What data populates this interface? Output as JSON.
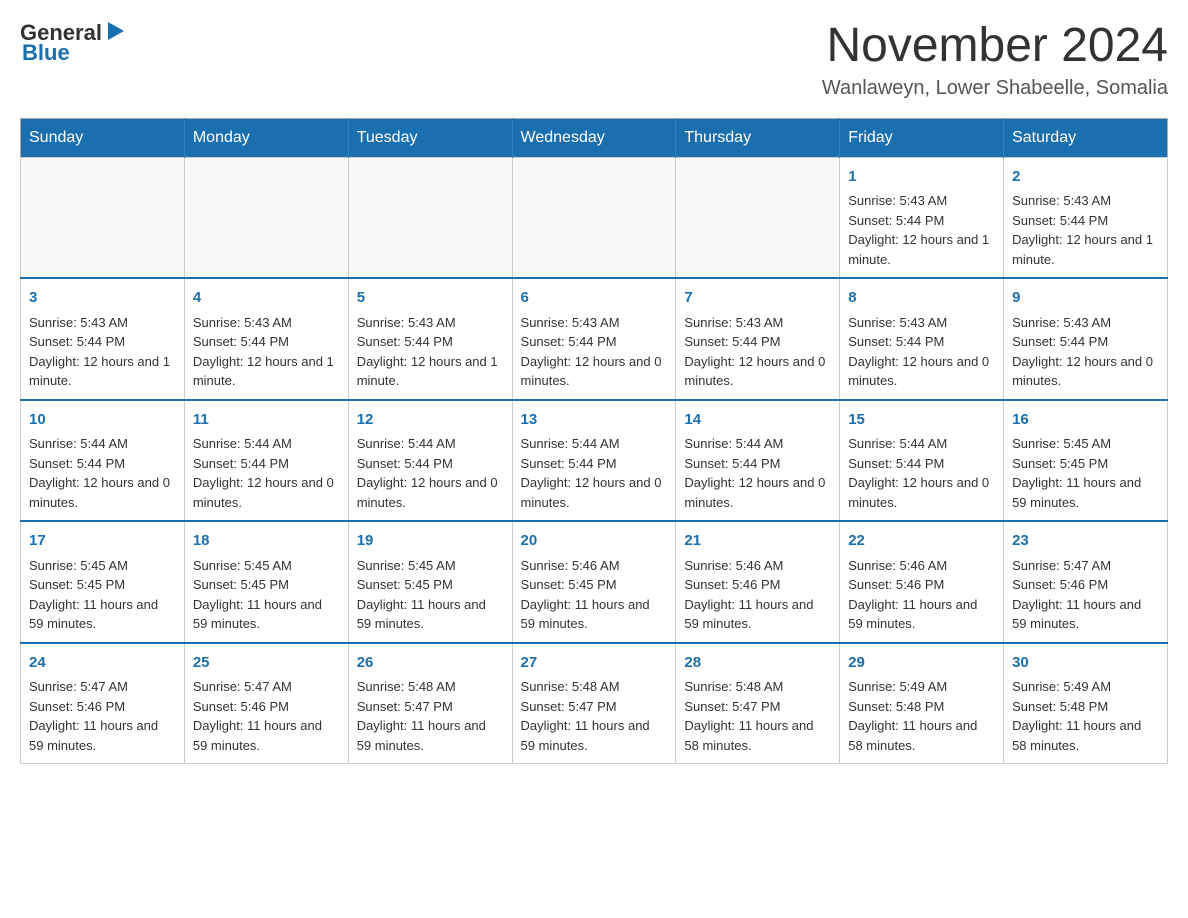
{
  "header": {
    "logo_general": "General",
    "logo_blue": "Blue",
    "month_title": "November 2024",
    "location": "Wanlaweyn, Lower Shabeelle, Somalia"
  },
  "weekdays": [
    "Sunday",
    "Monday",
    "Tuesday",
    "Wednesday",
    "Thursday",
    "Friday",
    "Saturday"
  ],
  "weeks": [
    {
      "days": [
        {
          "number": "",
          "sunrise": "",
          "sunset": "",
          "daylight": "",
          "empty": true
        },
        {
          "number": "",
          "sunrise": "",
          "sunset": "",
          "daylight": "",
          "empty": true
        },
        {
          "number": "",
          "sunrise": "",
          "sunset": "",
          "daylight": "",
          "empty": true
        },
        {
          "number": "",
          "sunrise": "",
          "sunset": "",
          "daylight": "",
          "empty": true
        },
        {
          "number": "",
          "sunrise": "",
          "sunset": "",
          "daylight": "",
          "empty": true
        },
        {
          "number": "1",
          "sunrise": "Sunrise: 5:43 AM",
          "sunset": "Sunset: 5:44 PM",
          "daylight": "Daylight: 12 hours and 1 minute.",
          "empty": false
        },
        {
          "number": "2",
          "sunrise": "Sunrise: 5:43 AM",
          "sunset": "Sunset: 5:44 PM",
          "daylight": "Daylight: 12 hours and 1 minute.",
          "empty": false
        }
      ]
    },
    {
      "days": [
        {
          "number": "3",
          "sunrise": "Sunrise: 5:43 AM",
          "sunset": "Sunset: 5:44 PM",
          "daylight": "Daylight: 12 hours and 1 minute.",
          "empty": false
        },
        {
          "number": "4",
          "sunrise": "Sunrise: 5:43 AM",
          "sunset": "Sunset: 5:44 PM",
          "daylight": "Daylight: 12 hours and 1 minute.",
          "empty": false
        },
        {
          "number": "5",
          "sunrise": "Sunrise: 5:43 AM",
          "sunset": "Sunset: 5:44 PM",
          "daylight": "Daylight: 12 hours and 1 minute.",
          "empty": false
        },
        {
          "number": "6",
          "sunrise": "Sunrise: 5:43 AM",
          "sunset": "Sunset: 5:44 PM",
          "daylight": "Daylight: 12 hours and 0 minutes.",
          "empty": false
        },
        {
          "number": "7",
          "sunrise": "Sunrise: 5:43 AM",
          "sunset": "Sunset: 5:44 PM",
          "daylight": "Daylight: 12 hours and 0 minutes.",
          "empty": false
        },
        {
          "number": "8",
          "sunrise": "Sunrise: 5:43 AM",
          "sunset": "Sunset: 5:44 PM",
          "daylight": "Daylight: 12 hours and 0 minutes.",
          "empty": false
        },
        {
          "number": "9",
          "sunrise": "Sunrise: 5:43 AM",
          "sunset": "Sunset: 5:44 PM",
          "daylight": "Daylight: 12 hours and 0 minutes.",
          "empty": false
        }
      ]
    },
    {
      "days": [
        {
          "number": "10",
          "sunrise": "Sunrise: 5:44 AM",
          "sunset": "Sunset: 5:44 PM",
          "daylight": "Daylight: 12 hours and 0 minutes.",
          "empty": false
        },
        {
          "number": "11",
          "sunrise": "Sunrise: 5:44 AM",
          "sunset": "Sunset: 5:44 PM",
          "daylight": "Daylight: 12 hours and 0 minutes.",
          "empty": false
        },
        {
          "number": "12",
          "sunrise": "Sunrise: 5:44 AM",
          "sunset": "Sunset: 5:44 PM",
          "daylight": "Daylight: 12 hours and 0 minutes.",
          "empty": false
        },
        {
          "number": "13",
          "sunrise": "Sunrise: 5:44 AM",
          "sunset": "Sunset: 5:44 PM",
          "daylight": "Daylight: 12 hours and 0 minutes.",
          "empty": false
        },
        {
          "number": "14",
          "sunrise": "Sunrise: 5:44 AM",
          "sunset": "Sunset: 5:44 PM",
          "daylight": "Daylight: 12 hours and 0 minutes.",
          "empty": false
        },
        {
          "number": "15",
          "sunrise": "Sunrise: 5:44 AM",
          "sunset": "Sunset: 5:44 PM",
          "daylight": "Daylight: 12 hours and 0 minutes.",
          "empty": false
        },
        {
          "number": "16",
          "sunrise": "Sunrise: 5:45 AM",
          "sunset": "Sunset: 5:45 PM",
          "daylight": "Daylight: 11 hours and 59 minutes.",
          "empty": false
        }
      ]
    },
    {
      "days": [
        {
          "number": "17",
          "sunrise": "Sunrise: 5:45 AM",
          "sunset": "Sunset: 5:45 PM",
          "daylight": "Daylight: 11 hours and 59 minutes.",
          "empty": false
        },
        {
          "number": "18",
          "sunrise": "Sunrise: 5:45 AM",
          "sunset": "Sunset: 5:45 PM",
          "daylight": "Daylight: 11 hours and 59 minutes.",
          "empty": false
        },
        {
          "number": "19",
          "sunrise": "Sunrise: 5:45 AM",
          "sunset": "Sunset: 5:45 PM",
          "daylight": "Daylight: 11 hours and 59 minutes.",
          "empty": false
        },
        {
          "number": "20",
          "sunrise": "Sunrise: 5:46 AM",
          "sunset": "Sunset: 5:45 PM",
          "daylight": "Daylight: 11 hours and 59 minutes.",
          "empty": false
        },
        {
          "number": "21",
          "sunrise": "Sunrise: 5:46 AM",
          "sunset": "Sunset: 5:46 PM",
          "daylight": "Daylight: 11 hours and 59 minutes.",
          "empty": false
        },
        {
          "number": "22",
          "sunrise": "Sunrise: 5:46 AM",
          "sunset": "Sunset: 5:46 PM",
          "daylight": "Daylight: 11 hours and 59 minutes.",
          "empty": false
        },
        {
          "number": "23",
          "sunrise": "Sunrise: 5:47 AM",
          "sunset": "Sunset: 5:46 PM",
          "daylight": "Daylight: 11 hours and 59 minutes.",
          "empty": false
        }
      ]
    },
    {
      "days": [
        {
          "number": "24",
          "sunrise": "Sunrise: 5:47 AM",
          "sunset": "Sunset: 5:46 PM",
          "daylight": "Daylight: 11 hours and 59 minutes.",
          "empty": false
        },
        {
          "number": "25",
          "sunrise": "Sunrise: 5:47 AM",
          "sunset": "Sunset: 5:46 PM",
          "daylight": "Daylight: 11 hours and 59 minutes.",
          "empty": false
        },
        {
          "number": "26",
          "sunrise": "Sunrise: 5:48 AM",
          "sunset": "Sunset: 5:47 PM",
          "daylight": "Daylight: 11 hours and 59 minutes.",
          "empty": false
        },
        {
          "number": "27",
          "sunrise": "Sunrise: 5:48 AM",
          "sunset": "Sunset: 5:47 PM",
          "daylight": "Daylight: 11 hours and 59 minutes.",
          "empty": false
        },
        {
          "number": "28",
          "sunrise": "Sunrise: 5:48 AM",
          "sunset": "Sunset: 5:47 PM",
          "daylight": "Daylight: 11 hours and 58 minutes.",
          "empty": false
        },
        {
          "number": "29",
          "sunrise": "Sunrise: 5:49 AM",
          "sunset": "Sunset: 5:48 PM",
          "daylight": "Daylight: 11 hours and 58 minutes.",
          "empty": false
        },
        {
          "number": "30",
          "sunrise": "Sunrise: 5:49 AM",
          "sunset": "Sunset: 5:48 PM",
          "daylight": "Daylight: 11 hours and 58 minutes.",
          "empty": false
        }
      ]
    }
  ]
}
